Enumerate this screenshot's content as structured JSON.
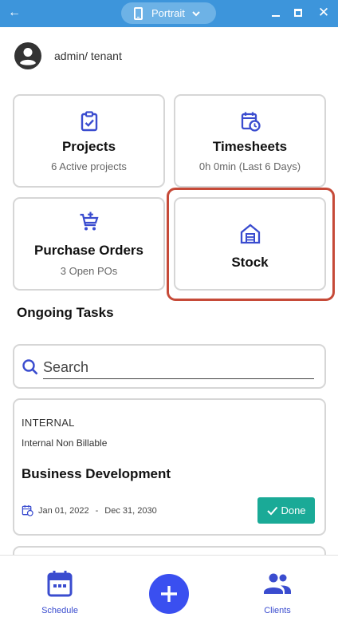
{
  "titlebar": {
    "orientation_label": "Portrait"
  },
  "user": {
    "name": "admin/ tenant"
  },
  "cards": {
    "projects": {
      "title": "Projects",
      "count": "6",
      "subtitle": "Active projects"
    },
    "timesheets": {
      "title": "Timesheets",
      "subtitle": "0h 0min  (Last 6 Days)"
    },
    "purchase_orders": {
      "title": "Purchase Orders",
      "count": "3",
      "subtitle": "Open POs"
    },
    "stock": {
      "title": "Stock"
    }
  },
  "ongoing": {
    "title": "Ongoing Tasks",
    "search_placeholder": "Search",
    "tasks": [
      {
        "type": "INTERNAL",
        "billing": "Internal Non Billable",
        "title": "Business Development",
        "start": "Jan 01, 2022",
        "separator": "-",
        "end": "Dec 31, 2030",
        "status": "Done"
      }
    ]
  },
  "bottom_nav": {
    "schedule_label": "Schedule",
    "clients_label": "Clients"
  },
  "colors": {
    "titlebar": "#3d95db",
    "primary": "#3a4ccf",
    "fab": "#3a4ff0",
    "done": "#1aaa97",
    "highlight": "#c64a38"
  },
  "icons": {
    "back": "arrow-left-icon",
    "orientation": "phone-icon",
    "user": "account-circle-icon",
    "projects": "clipboard-check-icon",
    "timesheets": "calendar-clock-icon",
    "purchase_orders": "cart-plus-icon",
    "stock": "warehouse-icon",
    "search": "search-icon",
    "dates": "calendar-clock-icon",
    "done": "check-icon",
    "schedule": "calendar-icon",
    "add": "plus-icon",
    "clients": "people-icon"
  }
}
